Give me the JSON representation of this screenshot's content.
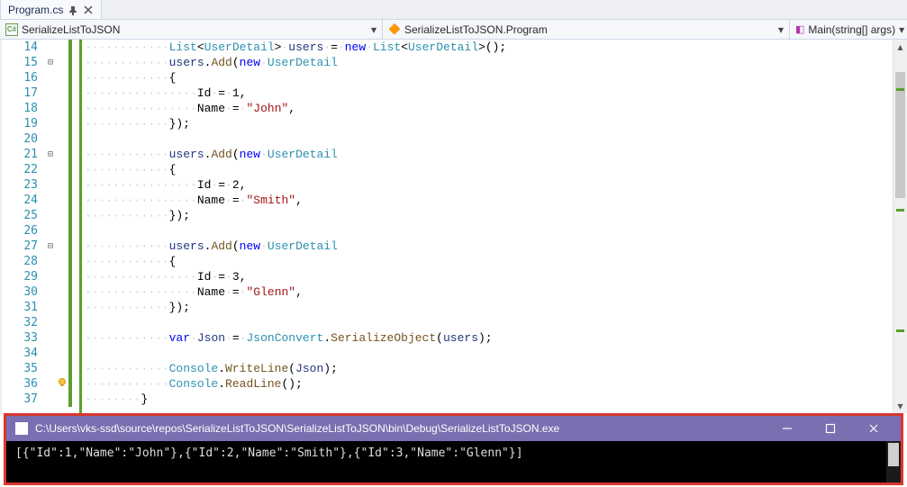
{
  "tab": {
    "title": "Program.cs"
  },
  "nav": {
    "project": "SerializeListToJSON",
    "namespace": "SerializeListToJSON.Program",
    "method": "Main(string[] args)"
  },
  "line_numbers": [
    14,
    15,
    16,
    17,
    18,
    19,
    20,
    21,
    22,
    23,
    24,
    25,
    26,
    27,
    28,
    29,
    30,
    31,
    32,
    33,
    34,
    35,
    36,
    37
  ],
  "fold_lines": [
    15,
    21,
    27
  ],
  "bulb_line": 36,
  "code": {
    "l14": {
      "ws": "············",
      "t1": "List",
      "t2": "UserDetail",
      "id": "users",
      "kw": "new",
      "t3": "List",
      "t4": "UserDetail"
    },
    "l15": {
      "ws": "············",
      "id": "users",
      "mth": "Add",
      "kw": "new",
      "cls": "UserDetail"
    },
    "l16": {
      "ws": "············",
      "brace": "{"
    },
    "l17": {
      "ws": "················",
      "p": "Id",
      "v": "1"
    },
    "l18": {
      "ws": "················",
      "p": "Name",
      "v": "\"John\""
    },
    "l19": {
      "ws": "············",
      "brace": "});"
    },
    "l20": {
      "ws": ""
    },
    "l21": {
      "ws": "············",
      "id": "users",
      "mth": "Add",
      "kw": "new",
      "cls": "UserDetail"
    },
    "l22": {
      "ws": "············",
      "brace": "{"
    },
    "l23": {
      "ws": "················",
      "p": "Id",
      "v": "2"
    },
    "l24": {
      "ws": "················",
      "p": "Name",
      "v": "\"Smith\""
    },
    "l25": {
      "ws": "············",
      "brace": "});"
    },
    "l26": {
      "ws": ""
    },
    "l27": {
      "ws": "············",
      "id": "users",
      "mth": "Add",
      "kw": "new",
      "cls": "UserDetail"
    },
    "l28": {
      "ws": "············",
      "brace": "{"
    },
    "l29": {
      "ws": "················",
      "p": "Id",
      "v": "3"
    },
    "l30": {
      "ws": "················",
      "p": "Name",
      "v": "\"Glenn\""
    },
    "l31": {
      "ws": "············",
      "brace": "});"
    },
    "l32": {
      "ws": ""
    },
    "l33": {
      "ws": "············",
      "kw": "var",
      "id": "Json",
      "cls": "JsonConvert",
      "mth": "SerializeObject",
      "arg": "users"
    },
    "l34": {
      "ws": ""
    },
    "l35": {
      "ws": "············",
      "cls": "Console",
      "mth": "WriteLine",
      "arg": "Json"
    },
    "l36": {
      "ws": "············",
      "cls": "Console",
      "mth": "ReadLine"
    },
    "l37": {
      "ws": "········",
      "brace": "}"
    }
  },
  "console": {
    "title": "C:\\Users\\vks-ssd\\source\\repos\\SerializeListToJSON\\SerializeListToJSON\\bin\\Debug\\SerializeListToJSON.exe",
    "output": "[{\"Id\":1,\"Name\":\"John\"},{\"Id\":2,\"Name\":\"Smith\"},{\"Id\":3,\"Name\":\"Glenn\"}]"
  }
}
